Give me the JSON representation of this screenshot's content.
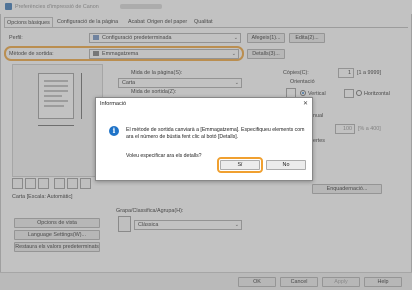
{
  "window": {
    "title": "Preferències d'impressió de Canon",
    "icon": "printer-icon"
  },
  "tabs": [
    {
      "label": "Opcions bàsiques",
      "active": true
    },
    {
      "label": "Configuració de la pàgina"
    },
    {
      "label": "Acabat"
    },
    {
      "label": "Origen del paper"
    },
    {
      "label": "Qualitat"
    }
  ],
  "profile": {
    "label": "Perfil:",
    "value": "Configuració predeterminada",
    "add_button": "Afegeix(1)...",
    "edit_button": "Edita(2)..."
  },
  "output": {
    "label": "Mètode de sortida:",
    "value": "Emmagatzema",
    "details_button": "Detalls(3)..."
  },
  "page": {
    "size_label": "Mida de la pàgina(S):",
    "size_value": "Carta",
    "output_size_label": "Mida de sortida(Z):",
    "copies_label": "Còpies(C):",
    "copies_value": "1",
    "copies_range": "[1 a 9999]",
    "orientation_label": "Orientació",
    "orientation_vertical": "Vertical",
    "orientation_horizontal": "Horitzontal",
    "scale_label": "nual",
    "scale_value": "100",
    "scale_range": "[% a 400]",
    "layout_suffix": "ertes"
  },
  "preview": {
    "caption": "Carta [Escala: Automàtic]"
  },
  "binding_button": "Enquadernació...",
  "color_mode": {
    "label": "Grapa/Classifica/Agrupa(H):",
    "value": "Clàssica"
  },
  "left_buttons": {
    "view_options": "Opcions de vista",
    "language": "Language Settings(W)...",
    "restore": "Restaura els valors predeterminats"
  },
  "dialog": {
    "title": "Informació",
    "message": "El mètode de sortida canviarà a [Emmagatzema]. Especifiqueu elements com ara el número de bústia fent clic al botó [Detalls].",
    "question": "Voleu especificar ara els detalls?",
    "yes": "Sí",
    "no": "No",
    "close_glyph": "✕",
    "info_glyph": "i"
  },
  "footer": {
    "ok": "OK",
    "cancel": "Cancel",
    "apply": "Apply",
    "help": "Help"
  },
  "colors": {
    "highlight": "#f0a030",
    "info_blue": "#1f73c8"
  }
}
